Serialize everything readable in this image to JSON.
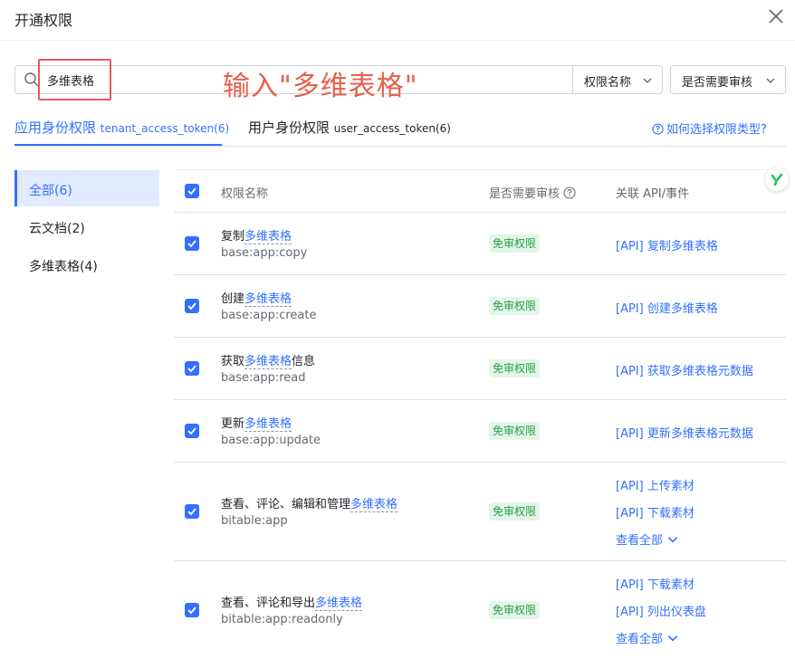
{
  "dialog": {
    "title": "开通权限"
  },
  "search": {
    "value": "多维表格"
  },
  "annotation": {
    "text": "输入\"多维表格\""
  },
  "filters": {
    "name": "权限名称",
    "review": "是否需要审核"
  },
  "tabs": [
    {
      "label": "应用身份权限",
      "sub": "tenant_access_token(6)"
    },
    {
      "label": "用户身份权限",
      "sub": "user_access_token(6)"
    }
  ],
  "help": {
    "label": "如何选择权限类型?"
  },
  "sidebar": {
    "items": [
      {
        "label": "全部(6)"
      },
      {
        "label": "云文档(2)"
      },
      {
        "label": "多维表格(4)"
      }
    ]
  },
  "table": {
    "headers": {
      "name": "权限名称",
      "review": "是否需要审核",
      "api": "关联 API/事件"
    },
    "rows": [
      {
        "prefix": "复制",
        "highlight": "多维表格",
        "suffix": "",
        "code": "base:app:copy",
        "badge": "免审权限",
        "apis": [
          "[API] 复制多维表格"
        ]
      },
      {
        "prefix": "创建",
        "highlight": "多维表格",
        "suffix": "",
        "code": "base:app:create",
        "badge": "免审权限",
        "apis": [
          "[API] 创建多维表格"
        ]
      },
      {
        "prefix": "获取",
        "highlight": "多维表格",
        "suffix": "信息",
        "code": "base:app:read",
        "badge": "免审权限",
        "apis": [
          "[API] 获取多维表格元数据"
        ]
      },
      {
        "prefix": "更新",
        "highlight": "多维表格",
        "suffix": "",
        "code": "base:app:update",
        "badge": "免审权限",
        "apis": [
          "[API] 更新多维表格元数据"
        ]
      },
      {
        "prefix": "查看、评论、编辑和管理",
        "highlight": "多维表格",
        "suffix": "",
        "code": "bitable:app",
        "badge": "免审权限",
        "apis": [
          "[API] 上传素材",
          "[API] 下载素材"
        ],
        "more": "查看全部"
      },
      {
        "prefix": "查看、评论和导出",
        "highlight": "多维表格",
        "suffix": "",
        "code": "bitable:app:readonly",
        "badge": "免审权限",
        "apis": [
          "[API] 下载素材",
          "[API] 列出仪表盘"
        ],
        "more": "查看全部"
      }
    ]
  },
  "colors": {
    "accent": "#3370ff",
    "badge_bg": "#e4f5e9",
    "badge_fg": "#24a148",
    "annotation": "#e5604d"
  }
}
